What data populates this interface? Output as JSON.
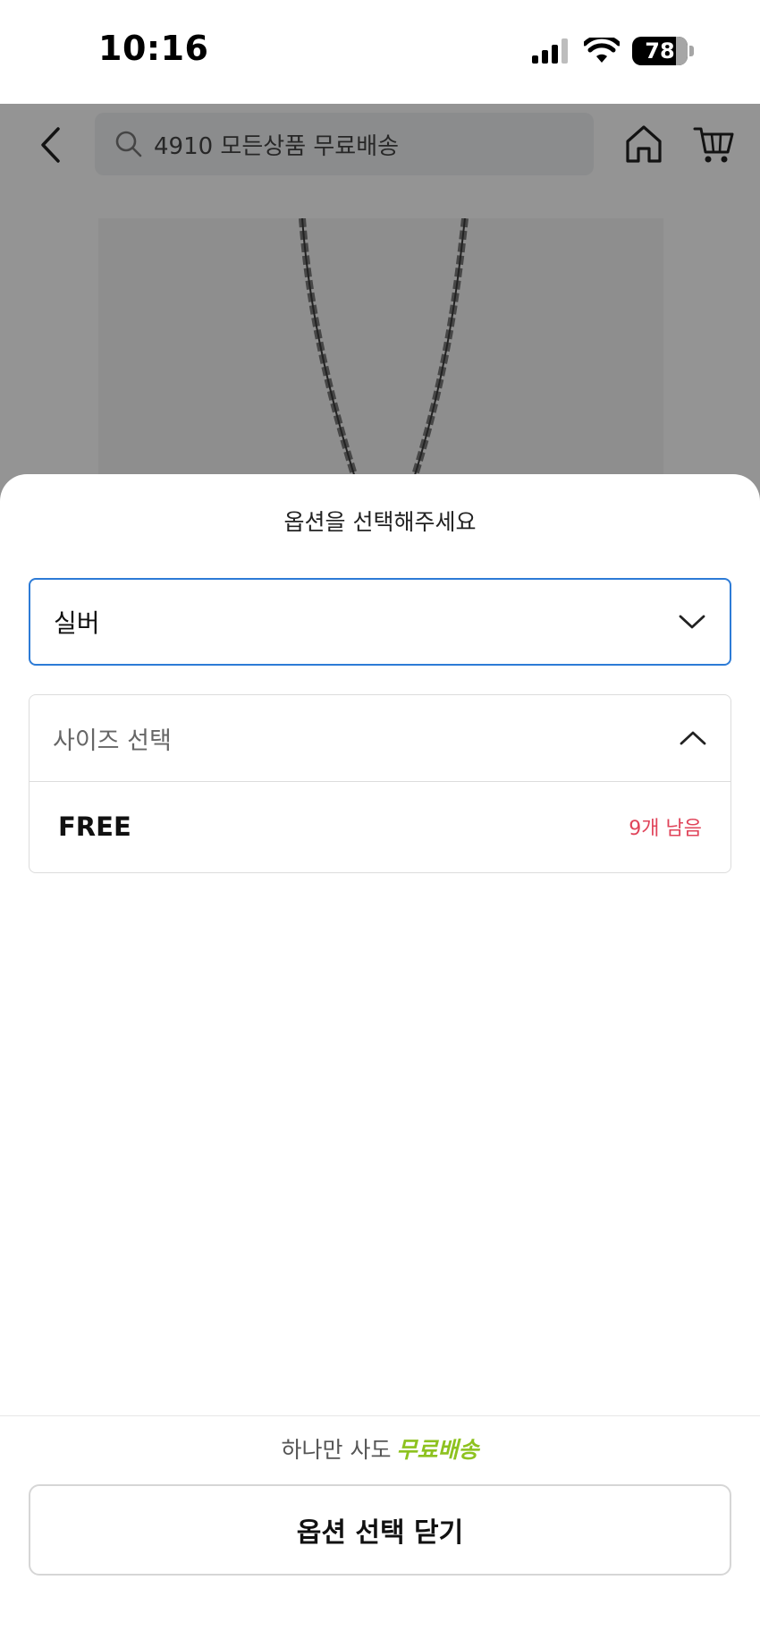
{
  "status_bar": {
    "time": "10:16",
    "battery": "78"
  },
  "header": {
    "search_text": "4910 모든상품 무료배송"
  },
  "sheet": {
    "title": "옵션을 선택해주세요",
    "color_option": {
      "value": "실버"
    },
    "size_option": {
      "label": "사이즈 선택",
      "items": [
        {
          "name": "FREE",
          "stock": "9개 남음"
        }
      ]
    },
    "promo_text": "하나만 사도",
    "promo_accent": "무료배송",
    "close_label": "옵션 선택 닫기"
  },
  "colors": {
    "accent_blue": "#2d7bd6",
    "stock_red": "#e0445a",
    "promo_green": "#8dc21f"
  }
}
